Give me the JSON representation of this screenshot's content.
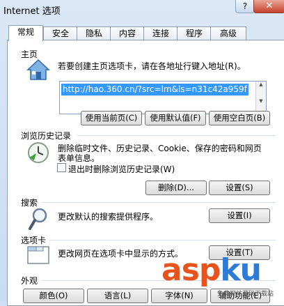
{
  "window": {
    "title": "Internet 选项",
    "help_label": "?",
    "close_label": "✕"
  },
  "tabs": [
    "常规",
    "安全",
    "隐私",
    "内容",
    "连接",
    "程序",
    "高级"
  ],
  "home": {
    "heading": "主页",
    "description": "若要创建主页选项卡，请在各地址行键入地址(R)。",
    "url": "http://hao.360.cn/?src=lm&ls=n31c42a959f",
    "buttons": [
      "使用当前页(C)",
      "使用默认值(F)",
      "使用空白页(B)"
    ]
  },
  "history": {
    "heading": "浏览历史记录",
    "description_line1": "删除临时文件、历史记录、Cookie、保存的密码和网页",
    "description_line2": "表单信息。",
    "checkbox_label": "退出时删除浏览历史记录(W)",
    "delete_button": "删除(D)...",
    "settings_button": "设置(S)"
  },
  "search": {
    "heading": "搜索",
    "description": "更改默认的搜索提供程序。",
    "settings_button": "设置(I)"
  },
  "tabs_section": {
    "heading": "选项卡",
    "description": "更改网页在选项卡中显示的方式。",
    "settings_button": "设置(T)"
  },
  "appearance": {
    "heading": "外观",
    "buttons": [
      "颜色(O)",
      "语言(L)",
      "字体(N)",
      "辅助功能(E)"
    ]
  },
  "watermark": {
    "main": "aspku",
    "sub": "免费网站源码下载站"
  },
  "icons": {
    "home": "home-icon",
    "history": "history-clock-icon",
    "search": "magnifier-icon",
    "tabs": "tab-window-icon"
  },
  "colors": {
    "selection": "#3399ff",
    "watermark_orange": "#e8531d",
    "watermark_blue": "#2d7bd6"
  }
}
